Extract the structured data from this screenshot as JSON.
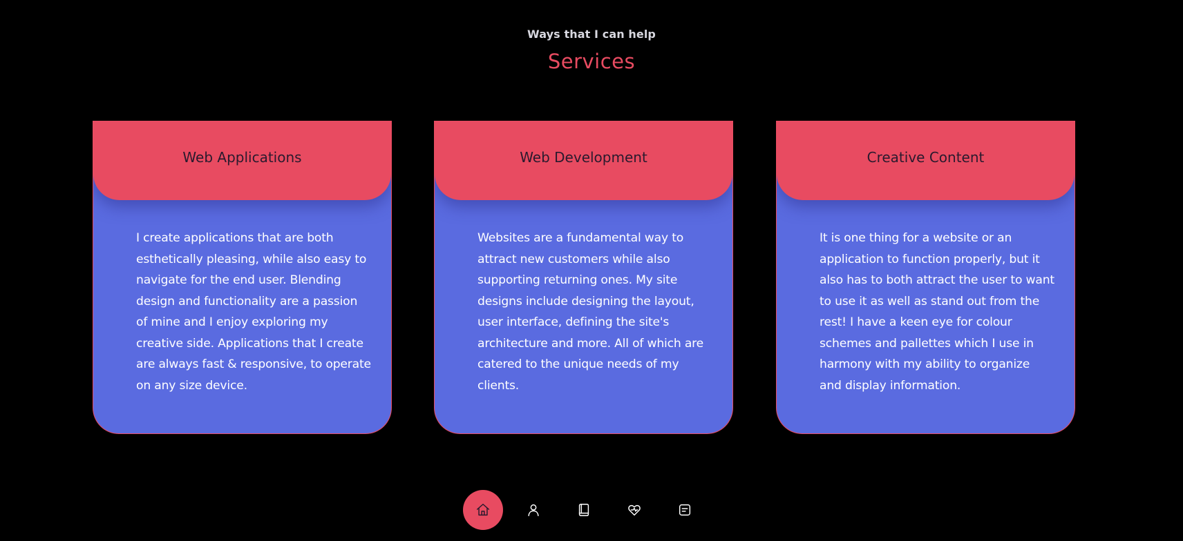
{
  "header": {
    "subtitle": "Ways that I can help",
    "title": "Services"
  },
  "cards": [
    {
      "title": "Web Applications",
      "body": "I create applications that are both esthetically pleasing, while also easy to navigate for the end user. Blending design and functionality are a passion of mine and I enjoy exploring my creative side. Applications that I create are always fast & responsive, to operate on any size device."
    },
    {
      "title": "Web Development",
      "body": "Websites are a fundamental way to attract new customers while also supporting returning ones. My site designs include designing the layout, user interface, defining the site's architecture and more. All of which are catered to the unique needs of my clients."
    },
    {
      "title": "Creative Content",
      "body": "It is one thing for a website or an application to function properly, but it also has to both attract the user to want to use it as well as stand out from the rest! I have a keen eye for colour schemes and pallettes which I use in harmony with my ability to organize and display information."
    }
  ],
  "nav": {
    "items": [
      {
        "icon": "home-icon",
        "active": true
      },
      {
        "icon": "user-icon",
        "active": false
      },
      {
        "icon": "book-icon",
        "active": false
      },
      {
        "icon": "heart-hand-icon",
        "active": false
      },
      {
        "icon": "message-icon",
        "active": false
      }
    ]
  },
  "colors": {
    "background": "#000000",
    "accent": "#e84b61",
    "card": "#5a6be0"
  }
}
